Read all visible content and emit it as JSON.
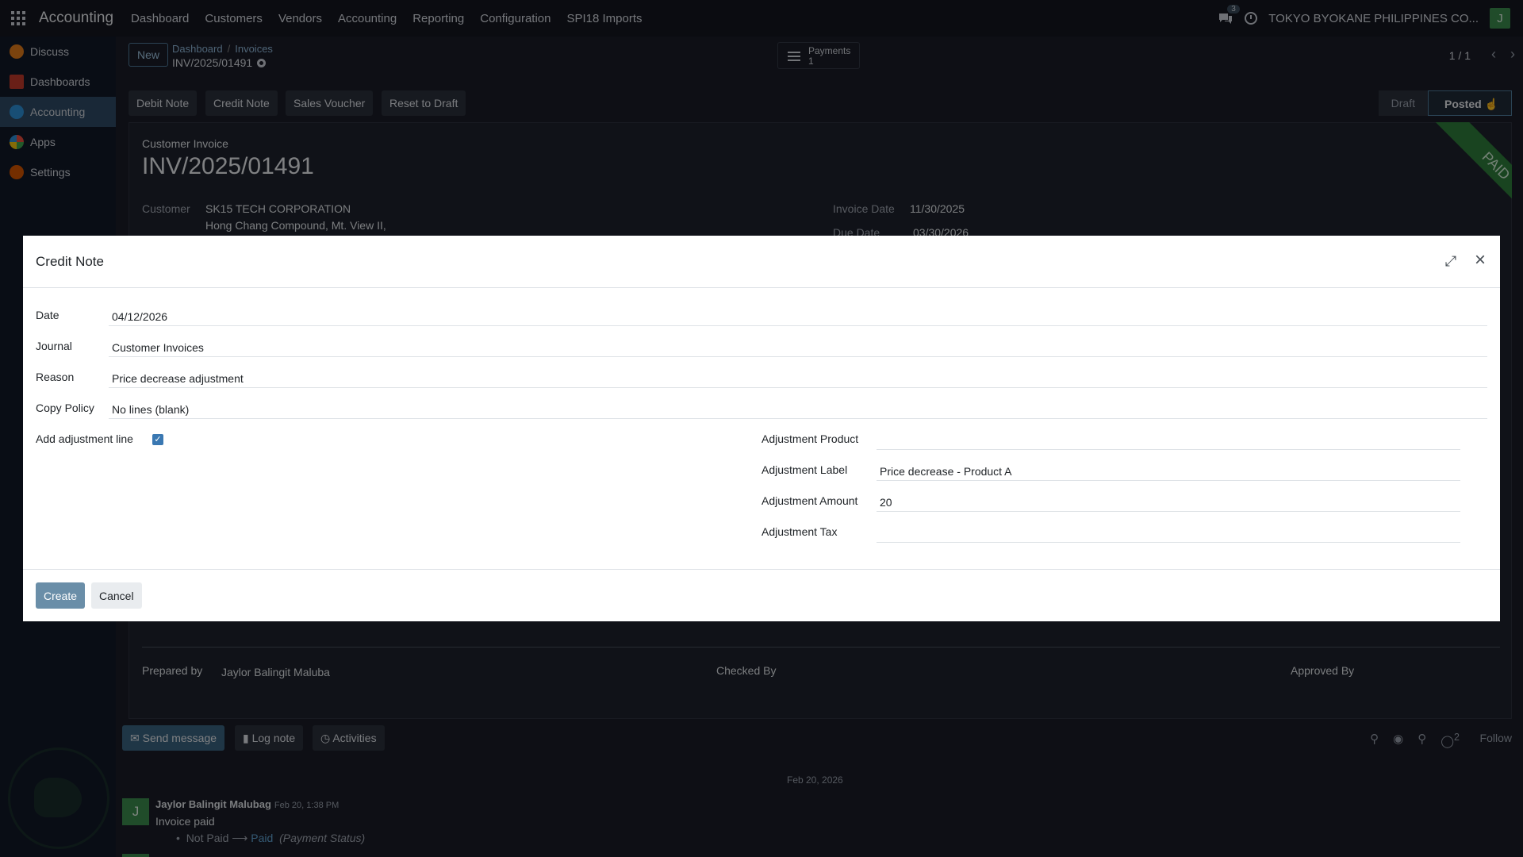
{
  "topbar": {
    "brand": "Accounting",
    "menu": [
      "Dashboard",
      "Customers",
      "Vendors",
      "Accounting",
      "Reporting",
      "Configuration",
      "SPI18 Imports"
    ],
    "chat_count": "3",
    "company": "TOKYO BYOKANE PHILIPPINES CO...",
    "user_initial": "J"
  },
  "sidebar": {
    "items": [
      {
        "label": "Discuss",
        "color": "#e07b1a"
      },
      {
        "label": "Dashboards",
        "color": "#c0392b"
      },
      {
        "label": "Accounting",
        "color": "#2d8fd5"
      },
      {
        "label": "Apps",
        "color": "#3fa34d"
      },
      {
        "label": "Settings",
        "color": "#d35400"
      }
    ]
  },
  "control": {
    "new_label": "New",
    "breadcrumb": [
      "Dashboard",
      "Invoices"
    ],
    "record_name": "INV/2025/01491",
    "payments_label": "Payments",
    "payments_count": "1",
    "pager": "1 / 1"
  },
  "actions": [
    "Debit Note",
    "Credit Note",
    "Sales Voucher",
    "Reset to Draft"
  ],
  "status": {
    "draft": "Draft",
    "posted": "Posted"
  },
  "invoice": {
    "type_label": "Customer Invoice",
    "number": "INV/2025/01491",
    "ribbon": "PAID",
    "customer_label": "Customer",
    "customer_name": "SK15 TECH CORPORATION",
    "customer_address": "Hong Chang Compound, Mt. View II,",
    "invoice_date_label": "Invoice Date",
    "invoice_date": "11/30/2025",
    "due_date_label": "Due Date",
    "due_date": "03/30/2026",
    "prepared_by_label": "Prepared by",
    "prepared_by": "Jaylor Balingit Maluba",
    "checked_by_label": "Checked By",
    "approved_by_label": "Approved By"
  },
  "chatter": {
    "send_message": "Send message",
    "log_note": "Log note",
    "activities": "Activities",
    "followers_count": "2",
    "follow": "Follow",
    "date_separator": "Feb 20, 2026",
    "author": "Jaylor Balingit Malubag",
    "time": "Feb 20, 1:38 PM",
    "body": "Invoice paid",
    "track_old": "Not Paid",
    "track_new": "Paid",
    "track_field": "(Payment Status)",
    "author_initial": "J"
  },
  "modal": {
    "title": "Credit Note",
    "fields": {
      "date_label": "Date",
      "date_value": "04/12/2026",
      "journal_label": "Journal",
      "journal_value": "Customer Invoices",
      "reason_label": "Reason",
      "reason_value": "Price decrease adjustment",
      "copy_policy_label": "Copy Policy",
      "copy_policy_value": "No lines (blank)",
      "add_adjustment_label": "Add adjustment line",
      "add_adjustment_checked": true,
      "adj_product_label": "Adjustment Product",
      "adj_product_value": "",
      "adj_label_label": "Adjustment Label",
      "adj_label_value": "Price decrease - Product A",
      "adj_amount_label": "Adjustment Amount",
      "adj_amount_value": "20",
      "adj_tax_label": "Adjustment Tax",
      "adj_tax_value": ""
    },
    "create_label": "Create",
    "cancel_label": "Cancel"
  }
}
